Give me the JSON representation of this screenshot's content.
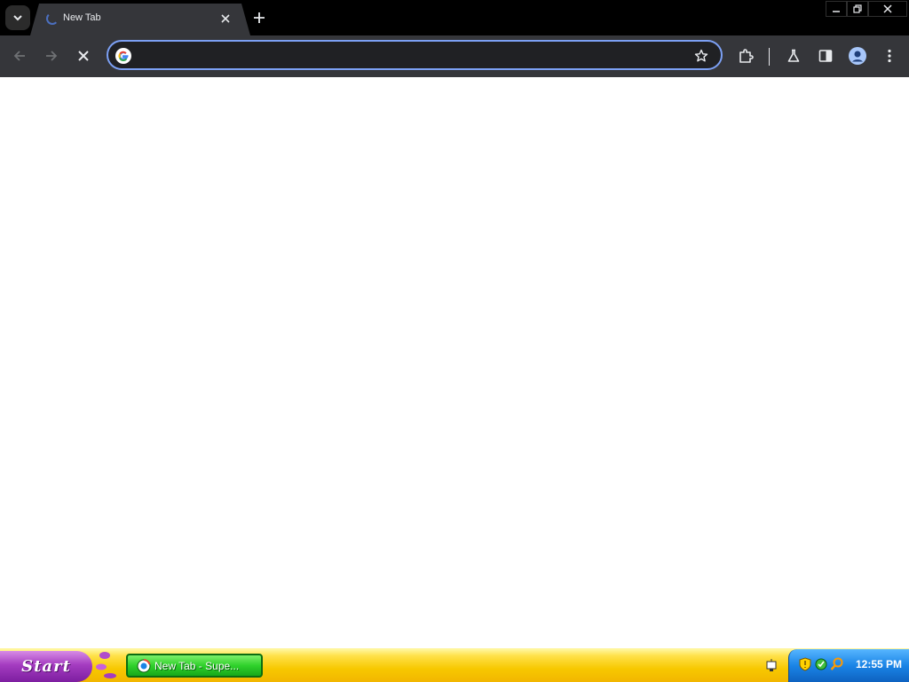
{
  "browser": {
    "tab": {
      "title": "New Tab"
    },
    "omnibox": {
      "value": "",
      "placeholder": ""
    }
  },
  "taskbar": {
    "start_label": "Start",
    "task_item_label": "New Tab - Supe...",
    "clock": "12:55 PM"
  },
  "colors": {
    "tab_strip": "#000000",
    "toolbar": "#35363a",
    "omnibox_border": "#7ca0f4",
    "start_button": "#a43cc0",
    "taskbar": "#f7c800",
    "task_item": "#2fd12b",
    "tray": "#1a84e6"
  },
  "icons": [
    "tab-search-icon",
    "loading-favicon-icon",
    "close-tab-icon",
    "new-tab-icon",
    "minimize-icon",
    "restore-icon",
    "close-window-icon",
    "back-icon",
    "forward-icon",
    "stop-icon",
    "google-icon",
    "star-icon",
    "extensions-icon",
    "labs-icon",
    "side-panel-icon",
    "profile-icon",
    "menu-icon",
    "network-icon",
    "shield-icon",
    "security-icon",
    "search-icon"
  ]
}
